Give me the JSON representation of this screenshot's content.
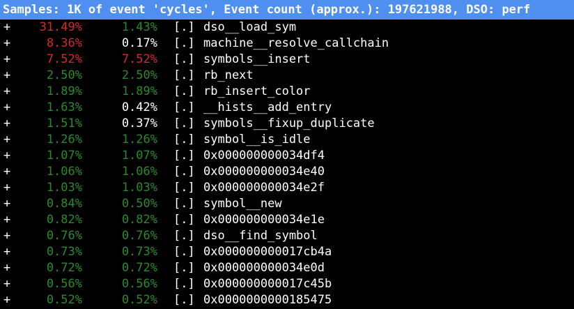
{
  "header": {
    "text": "Samples: 1K of event 'cycles', Event count (approx.): 197621988, DSO: perf"
  },
  "colors": {
    "header_bg": "#4f8ff0",
    "high": "#d22b2b",
    "normal": "#2a8a2a",
    "neutral": "#ffffff",
    "background": "#000000"
  },
  "rows": [
    {
      "expand": "+",
      "children": "31.49%",
      "children_color": "red",
      "self": "1.43%",
      "self_color": "green",
      "type": "[.]",
      "symbol": "dso__load_sym"
    },
    {
      "expand": "+",
      "children": "8.36%",
      "children_color": "red",
      "self": "0.17%",
      "self_color": "white",
      "type": "[.]",
      "symbol": "machine__resolve_callchain"
    },
    {
      "expand": "+",
      "children": "7.52%",
      "children_color": "red",
      "self": "7.52%",
      "self_color": "red",
      "type": "[.]",
      "symbol": "symbols__insert"
    },
    {
      "expand": "+",
      "children": "2.50%",
      "children_color": "green",
      "self": "2.50%",
      "self_color": "green",
      "type": "[.]",
      "symbol": "rb_next"
    },
    {
      "expand": "+",
      "children": "1.89%",
      "children_color": "green",
      "self": "1.89%",
      "self_color": "green",
      "type": "[.]",
      "symbol": "rb_insert_color"
    },
    {
      "expand": "+",
      "children": "1.63%",
      "children_color": "green",
      "self": "0.42%",
      "self_color": "white",
      "type": "[.]",
      "symbol": "__hists__add_entry"
    },
    {
      "expand": "+",
      "children": "1.51%",
      "children_color": "green",
      "self": "0.37%",
      "self_color": "white",
      "type": "[.]",
      "symbol": "symbols__fixup_duplicate"
    },
    {
      "expand": "+",
      "children": "1.26%",
      "children_color": "green",
      "self": "1.26%",
      "self_color": "green",
      "type": "[.]",
      "symbol": "symbol__is_idle"
    },
    {
      "expand": "+",
      "children": "1.07%",
      "children_color": "green",
      "self": "1.07%",
      "self_color": "green",
      "type": "[.]",
      "symbol": "0x000000000034df4"
    },
    {
      "expand": "+",
      "children": "1.06%",
      "children_color": "green",
      "self": "1.06%",
      "self_color": "green",
      "type": "[.]",
      "symbol": "0x000000000034e40"
    },
    {
      "expand": "+",
      "children": "1.03%",
      "children_color": "green",
      "self": "1.03%",
      "self_color": "green",
      "type": "[.]",
      "symbol": "0x000000000034e2f"
    },
    {
      "expand": "+",
      "children": "0.84%",
      "children_color": "green",
      "self": "0.50%",
      "self_color": "green",
      "type": "[.]",
      "symbol": "symbol__new"
    },
    {
      "expand": "+",
      "children": "0.82%",
      "children_color": "green",
      "self": "0.82%",
      "self_color": "green",
      "type": "[.]",
      "symbol": "0x000000000034e1e"
    },
    {
      "expand": "+",
      "children": "0.76%",
      "children_color": "green",
      "self": "0.76%",
      "self_color": "green",
      "type": "[.]",
      "symbol": "dso__find_symbol"
    },
    {
      "expand": "+",
      "children": "0.73%",
      "children_color": "green",
      "self": "0.73%",
      "self_color": "green",
      "type": "[.]",
      "symbol": "0x000000000017cb4a"
    },
    {
      "expand": "+",
      "children": "0.72%",
      "children_color": "green",
      "self": "0.72%",
      "self_color": "green",
      "type": "[.]",
      "symbol": "0x000000000034e0d"
    },
    {
      "expand": "+",
      "children": "0.56%",
      "children_color": "green",
      "self": "0.56%",
      "self_color": "green",
      "type": "[.]",
      "symbol": "0x000000000017c45b"
    },
    {
      "expand": "+",
      "children": "0.52%",
      "children_color": "green",
      "self": "0.52%",
      "self_color": "green",
      "type": "[.]",
      "symbol": "0x0000000000185475"
    }
  ]
}
